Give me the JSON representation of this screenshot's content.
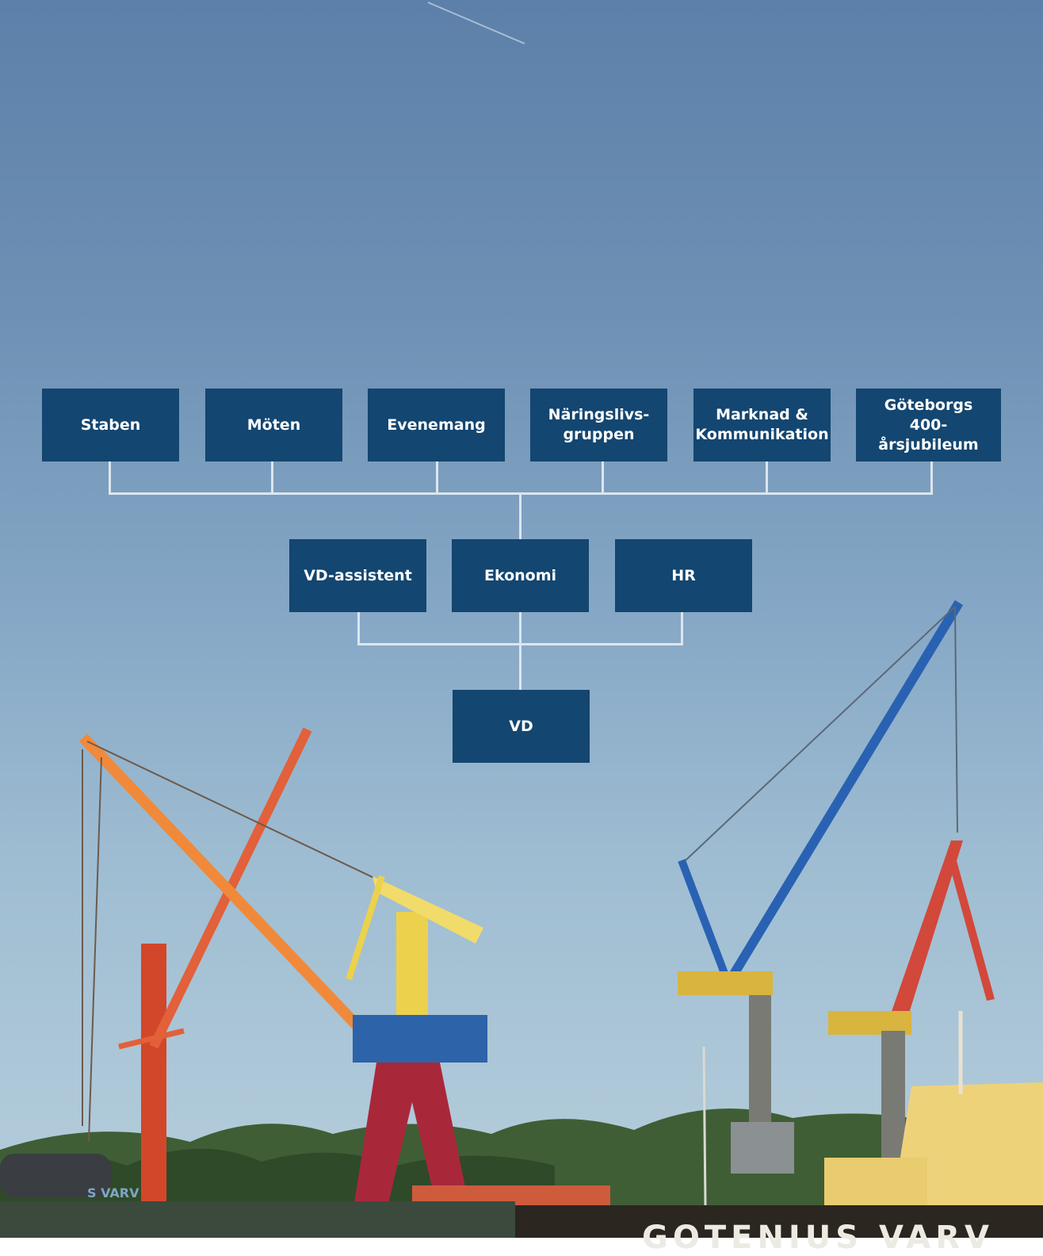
{
  "org_chart": {
    "top_row": [
      {
        "label": "Staben"
      },
      {
        "label": "Möten"
      },
      {
        "label": "Evenemang"
      },
      {
        "label": "Näringslivs-\ngruppen"
      },
      {
        "label": "Marknad &\nKommunikation"
      },
      {
        "label": "Göteborgs\n400-årsjubileum"
      }
    ],
    "middle_row": [
      {
        "label": "VD-assistent"
      },
      {
        "label": "Ekonomi"
      },
      {
        "label": "HR"
      }
    ],
    "root": {
      "label": "VD"
    }
  },
  "background_image": {
    "lettering": "GOTENIUS VARV",
    "sign_lettering": "S VARV"
  },
  "colors": {
    "box": "#134670",
    "connector": "#dce6ee",
    "sky_top": "#5c80a9",
    "sky_bottom": "#b7cfdc"
  }
}
